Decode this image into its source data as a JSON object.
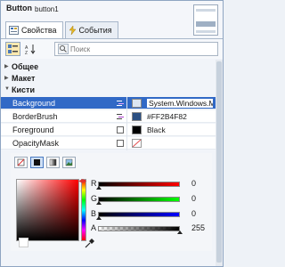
{
  "header": {
    "object_type": "Button",
    "object_name": "button1"
  },
  "tabs": [
    {
      "label": "Свойства",
      "active": true
    },
    {
      "label": "События",
      "active": false
    }
  ],
  "toolbar": {
    "search_placeholder": "Поиск"
  },
  "categories": [
    {
      "label": "Общее",
      "expanded": false
    },
    {
      "label": "Макет",
      "expanded": false
    },
    {
      "label": "Кисти",
      "expanded": true
    }
  ],
  "properties": [
    {
      "name": "Background",
      "value": "System.Windows.M",
      "selected": true,
      "swatch": "#dce6f2"
    },
    {
      "name": "BorderBrush",
      "value": "#FF2B4F82",
      "selected": false,
      "swatch": "#2B4F82"
    },
    {
      "name": "Foreground",
      "value": "Black",
      "selected": false,
      "swatch": "#000000"
    },
    {
      "name": "OpacityMask",
      "value": "",
      "selected": false,
      "swatch": "none"
    }
  ],
  "brush_editor": {
    "brush_types": [
      "no-brush",
      "solid-brush",
      "gradient-brush",
      "tile-brush"
    ],
    "active_brush": "solid-brush",
    "channels": [
      {
        "label": "R",
        "value": "0"
      },
      {
        "label": "G",
        "value": "0"
      },
      {
        "label": "B",
        "value": "0"
      },
      {
        "label": "A",
        "value": "255"
      }
    ]
  },
  "colors": {
    "selection": "#3169c6",
    "accent_border": "#8fa5c2"
  }
}
